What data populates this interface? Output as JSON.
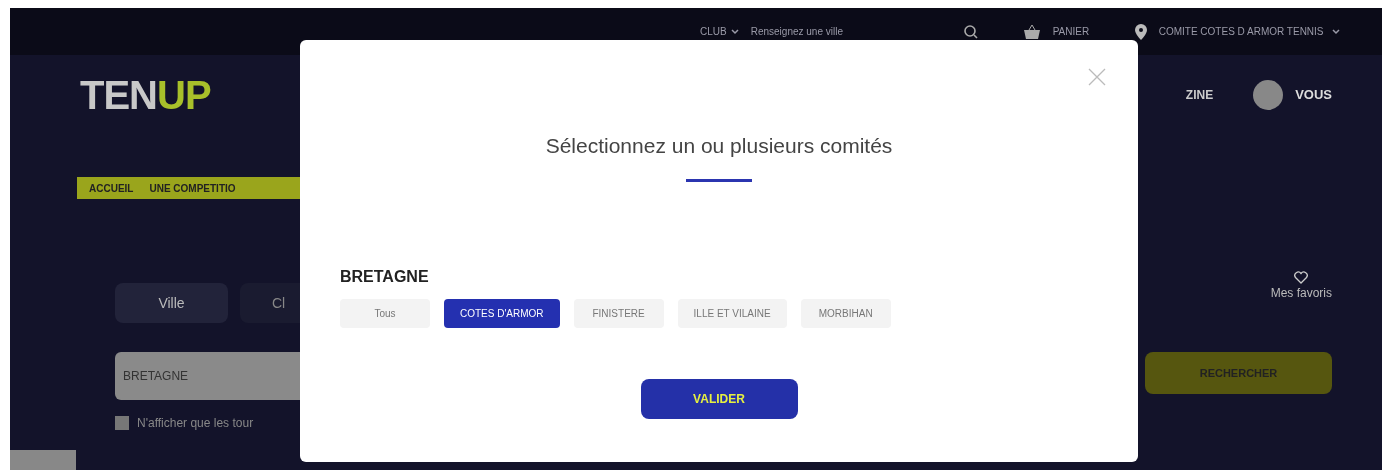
{
  "top_bar": {
    "club_selector": "CLUB",
    "city_placeholder": "Renseignez une ville",
    "basket_label": "PANIER",
    "committee_selector": "COMITE COTES D ARMOR TENNIS"
  },
  "header": {
    "logo": {
      "first": "TEN",
      "second": "UP"
    },
    "nav_fragment": "ZINE",
    "account_label": "VOUS"
  },
  "breadcrumb": [
    "ACCUEIL",
    "UNE COMPETITIO"
  ],
  "search_tabs": [
    {
      "label": "Ville",
      "selected": true
    },
    {
      "label": "Cl",
      "selected": false
    }
  ],
  "favorites_label": "Mes favoris",
  "region_field": {
    "value": "BRETAGNE"
  },
  "search_button": "RECHERCHER",
  "filter_checkbox": {
    "label": "N'afficher que les tour",
    "checked": false
  },
  "modal": {
    "title": "Sélectionnez un ou plusieurs comités",
    "region": "BRETAGNE",
    "committees": [
      {
        "label": "Tous",
        "selected": false
      },
      {
        "label": "COTES D'ARMOR",
        "selected": true
      },
      {
        "label": "FINISTERE",
        "selected": false
      },
      {
        "label": "ILLE ET VILAINE",
        "selected": false
      },
      {
        "label": "MORBIHAN",
        "selected": false
      }
    ],
    "confirm_button": "VALIDER"
  }
}
